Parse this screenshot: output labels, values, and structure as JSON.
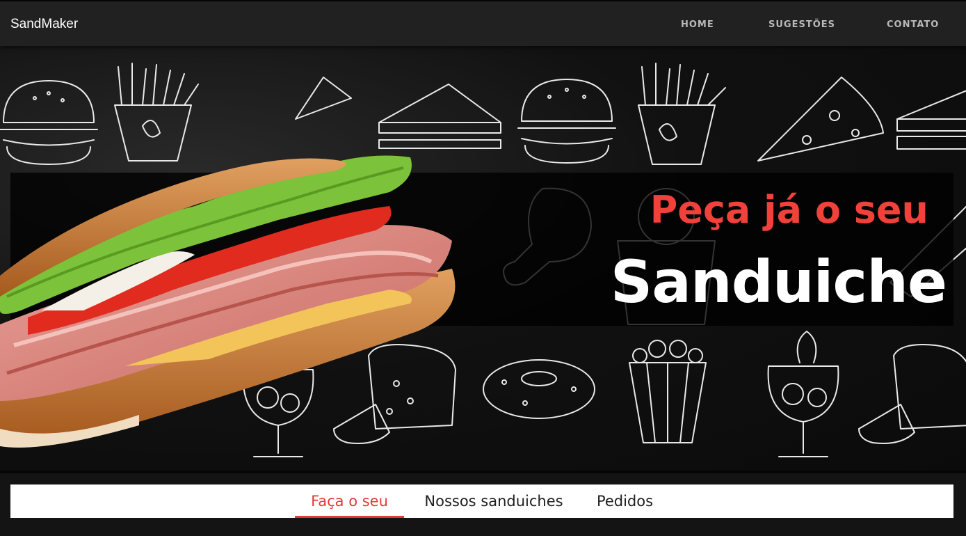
{
  "navbar": {
    "brand": "SandMaker",
    "links": [
      "HOME",
      "SUGESTÕES",
      "CONTATO"
    ]
  },
  "hero": {
    "title_line1": "Peça já o seu",
    "title_line2": "Sanduiche",
    "accent_color": "#f0413a",
    "background_icons": [
      "burger-icon",
      "fries-icon",
      "pizza-slice-icon",
      "sandwich-icon",
      "chicken-leg-icon",
      "ice-cream-icon",
      "drink-glass-icon",
      "bread-loaf-icon",
      "donut-icon",
      "popcorn-icon"
    ]
  },
  "tabs": {
    "items": [
      "Faça o seu",
      "Nossos sanduiches",
      "Pedidos"
    ],
    "active_index": 0,
    "active_color": "#e53935"
  }
}
